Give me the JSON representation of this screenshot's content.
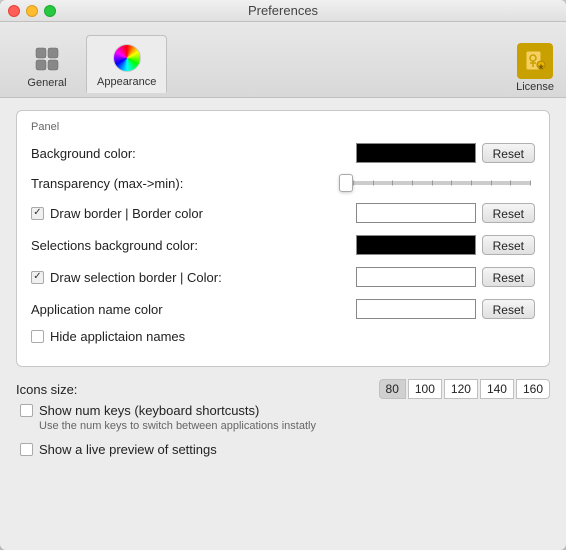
{
  "window": {
    "title": "Preferences"
  },
  "toolbar": {
    "tabs": [
      {
        "id": "general",
        "label": "General",
        "active": false
      },
      {
        "id": "appearance",
        "label": "Appearance",
        "active": true
      }
    ],
    "license_label": "License"
  },
  "panel": {
    "legend": "Panel",
    "rows": [
      {
        "id": "background-color",
        "label": "Background color:",
        "has_color": true,
        "color_black": true,
        "has_reset": true,
        "reset_label": "Reset"
      },
      {
        "id": "transparency",
        "label": "Transparency (max->min):",
        "is_slider": true
      },
      {
        "id": "draw-border",
        "label": "Draw border | Border color",
        "has_checkbox": true,
        "checked": true,
        "has_color": true,
        "color_black": false,
        "has_reset": true,
        "reset_label": "Reset"
      },
      {
        "id": "selections-bg",
        "label": "Selections background color:",
        "has_color": true,
        "color_black": true,
        "has_reset": true,
        "reset_label": "Reset"
      },
      {
        "id": "draw-selection-border",
        "label": "Draw selection border | Color:",
        "has_checkbox": true,
        "checked": true,
        "has_color": true,
        "color_black": false,
        "has_reset": true,
        "reset_label": "Reset"
      },
      {
        "id": "app-name-color",
        "label": "Application name color",
        "has_color": true,
        "color_black": false,
        "has_reset": true,
        "reset_label": "Reset"
      },
      {
        "id": "hide-app-names",
        "label": "Hide applictaion names",
        "has_checkbox": true,
        "checked": false
      }
    ]
  },
  "icons_size": {
    "label": "Icons size:",
    "options": [
      "80",
      "100",
      "120",
      "140",
      "160"
    ],
    "selected": "80"
  },
  "bottom": {
    "show_num_keys": {
      "label": "Show num keys (keyboard shortcusts)",
      "sub_label": "Use the num keys to switch between applications instatly",
      "checked": false
    },
    "show_live_preview": {
      "label": "Show a live preview of settings",
      "checked": false
    }
  }
}
